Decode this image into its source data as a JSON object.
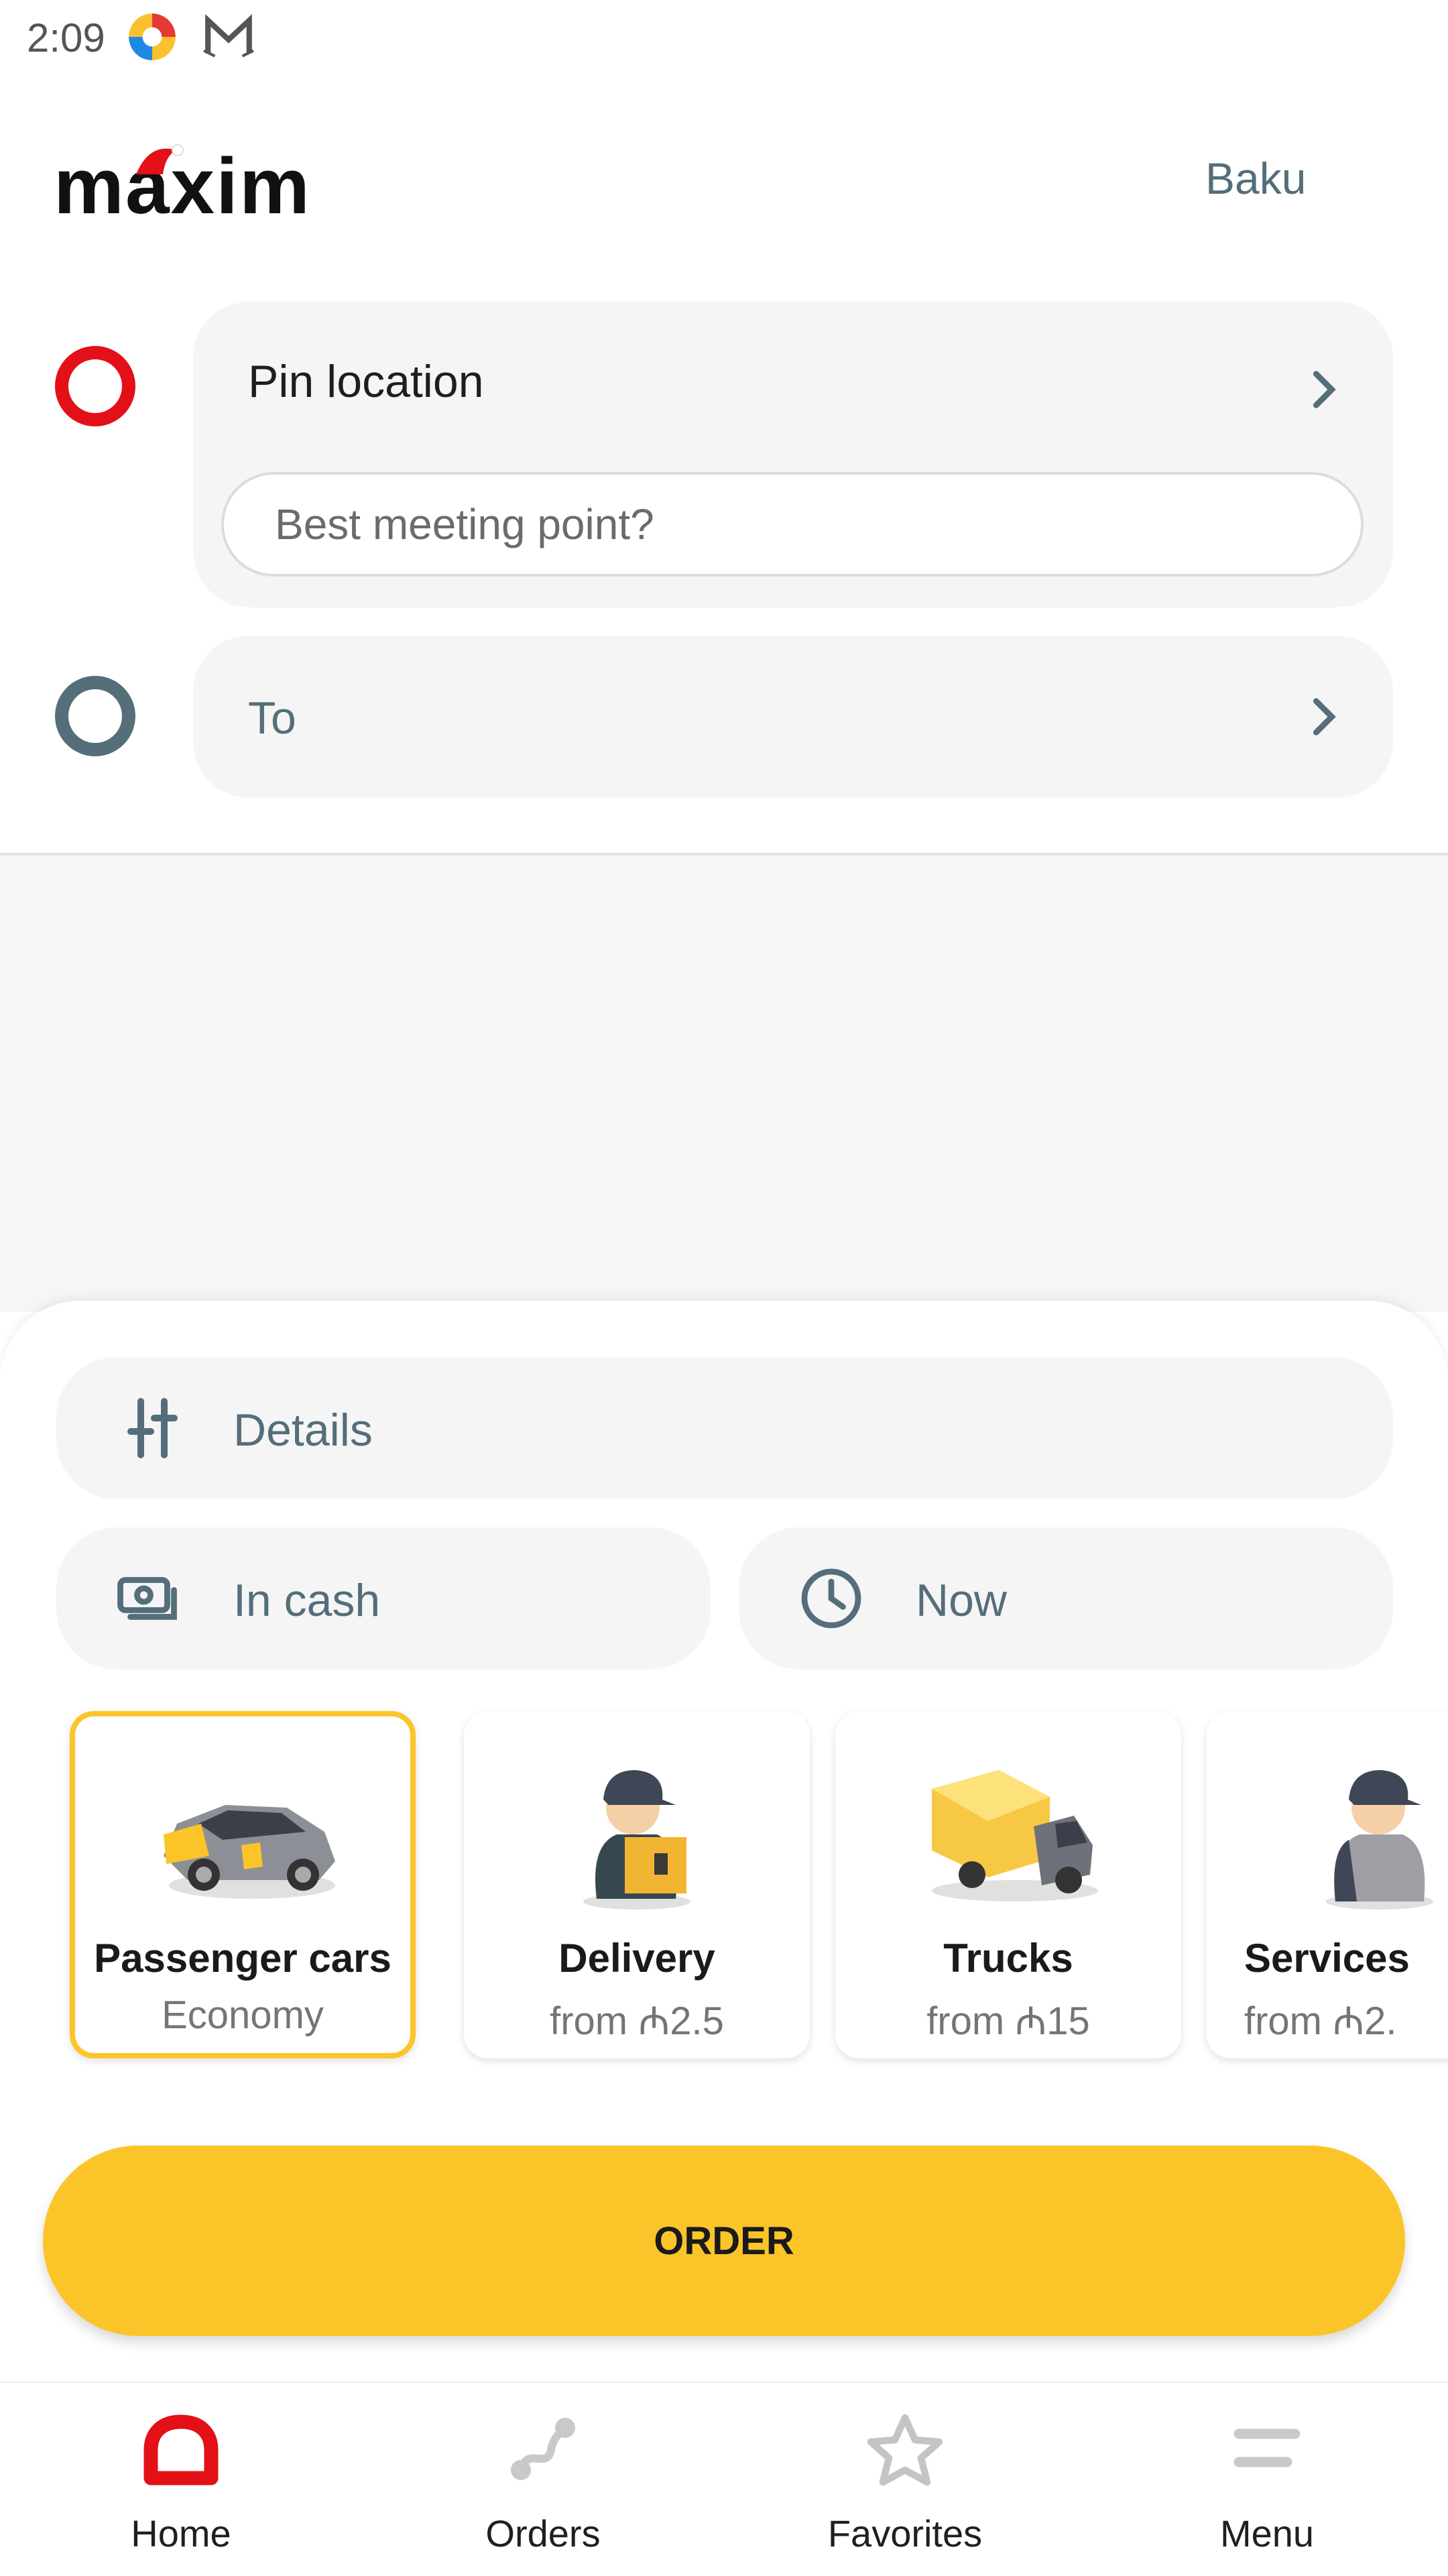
{
  "status_bar": {
    "time": "2:09"
  },
  "header": {
    "logo_text": "maxim",
    "city": "Baku"
  },
  "route": {
    "from_label": "Pin location",
    "meeting_placeholder": "Best meeting point?",
    "to_label": "To"
  },
  "options": {
    "details_label": "Details",
    "payment_label": "In cash",
    "time_label": "Now"
  },
  "categories": [
    {
      "title": "Passenger cars",
      "subtitle": "Economy",
      "icon": "car-icon",
      "selected": true
    },
    {
      "title": "Delivery",
      "subtitle": "from ₼2.5",
      "icon": "courier-icon",
      "selected": false
    },
    {
      "title": "Trucks",
      "subtitle": "from ₼15",
      "icon": "truck-icon",
      "selected": false
    },
    {
      "title": "Services",
      "subtitle": "from ₼2.",
      "icon": "worker-icon",
      "selected": false
    }
  ],
  "order_label": "ORDER",
  "nav": [
    {
      "label": "Home",
      "icon": "home-icon",
      "active": true
    },
    {
      "label": "Orders",
      "icon": "route-icon",
      "active": false
    },
    {
      "label": "Favorites",
      "icon": "star-icon",
      "active": false
    },
    {
      "label": "Menu",
      "icon": "menu-icon",
      "active": false
    }
  ],
  "colors": {
    "accent": "#fbc52a",
    "brand_red": "#e31018",
    "icon_gray": "#546e7a"
  }
}
